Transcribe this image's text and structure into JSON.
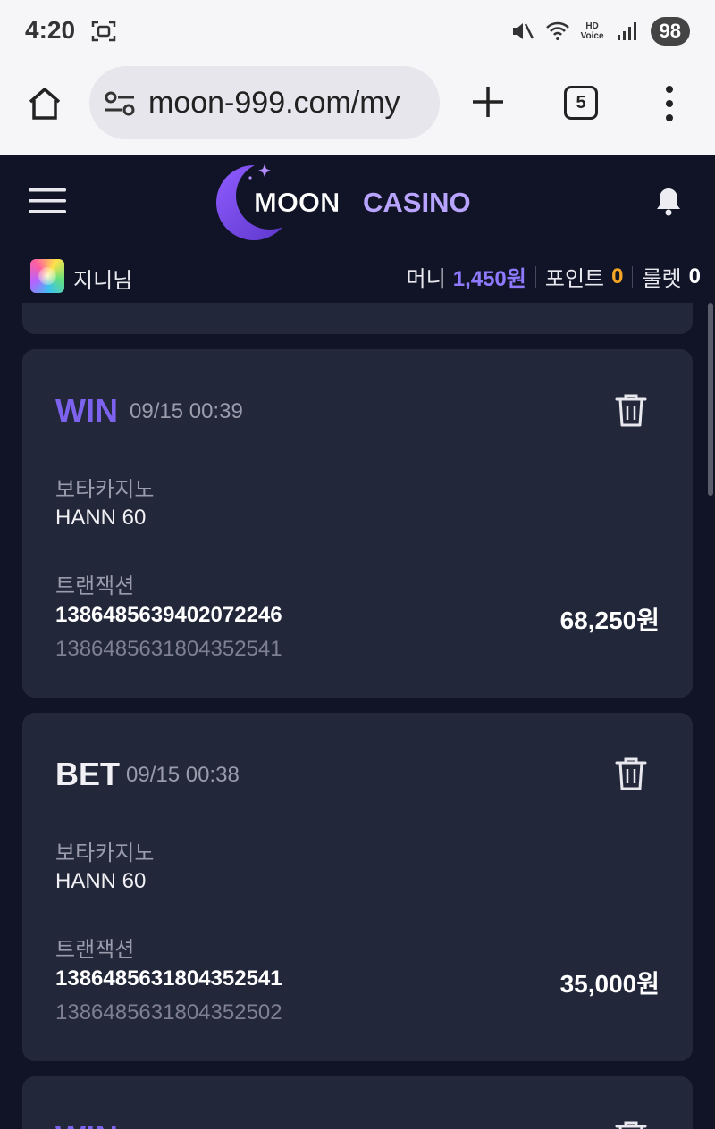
{
  "status_bar": {
    "time": "4:20",
    "battery": "98",
    "hd_label": "HD",
    "voice_label": "Voice",
    "icons": [
      "screenshot-icon",
      "mute-icon",
      "wifi-icon",
      "hd-voice-icon",
      "signal-icon",
      "battery-icon"
    ]
  },
  "browser": {
    "url": "moon-999.com/my",
    "tab_count": "5",
    "icons": [
      "home-icon",
      "site-settings-icon",
      "new-tab-icon",
      "tabs-icon",
      "more-icon"
    ]
  },
  "site": {
    "logo_text_moon": "MOON",
    "logo_text_casino": "CASINO",
    "icons": [
      "hamburger-menu-icon",
      "bell-icon"
    ]
  },
  "user": {
    "name": "지니님",
    "money_label": "머니",
    "money_value": "1,450원",
    "point_label": "포인트",
    "point_value": "0",
    "roulette_label": "룰렛",
    "roulette_value": "0"
  },
  "transactions": [
    {
      "type": "WIN",
      "datetime": "09/15 00:39",
      "provider": "보타카지노",
      "game": "HANN 60",
      "transaction_label": "트랜잭션",
      "transaction_id": "1386485639402072246",
      "ref_id": "1386485631804352541",
      "amount": "68,250원"
    },
    {
      "type": "BET",
      "datetime": "09/15 00:38",
      "provider": "보타카지노",
      "game": "HANN 60",
      "transaction_label": "트랜잭션",
      "transaction_id": "1386485631804352541",
      "ref_id": "1386485631804352502",
      "amount": "35,000원"
    },
    {
      "type": "WIN"
    }
  ],
  "colors": {
    "background": "#111426",
    "card": "#23273a",
    "win": "#7d62ee",
    "money": "#8e79ff",
    "point": "#f5a623"
  }
}
